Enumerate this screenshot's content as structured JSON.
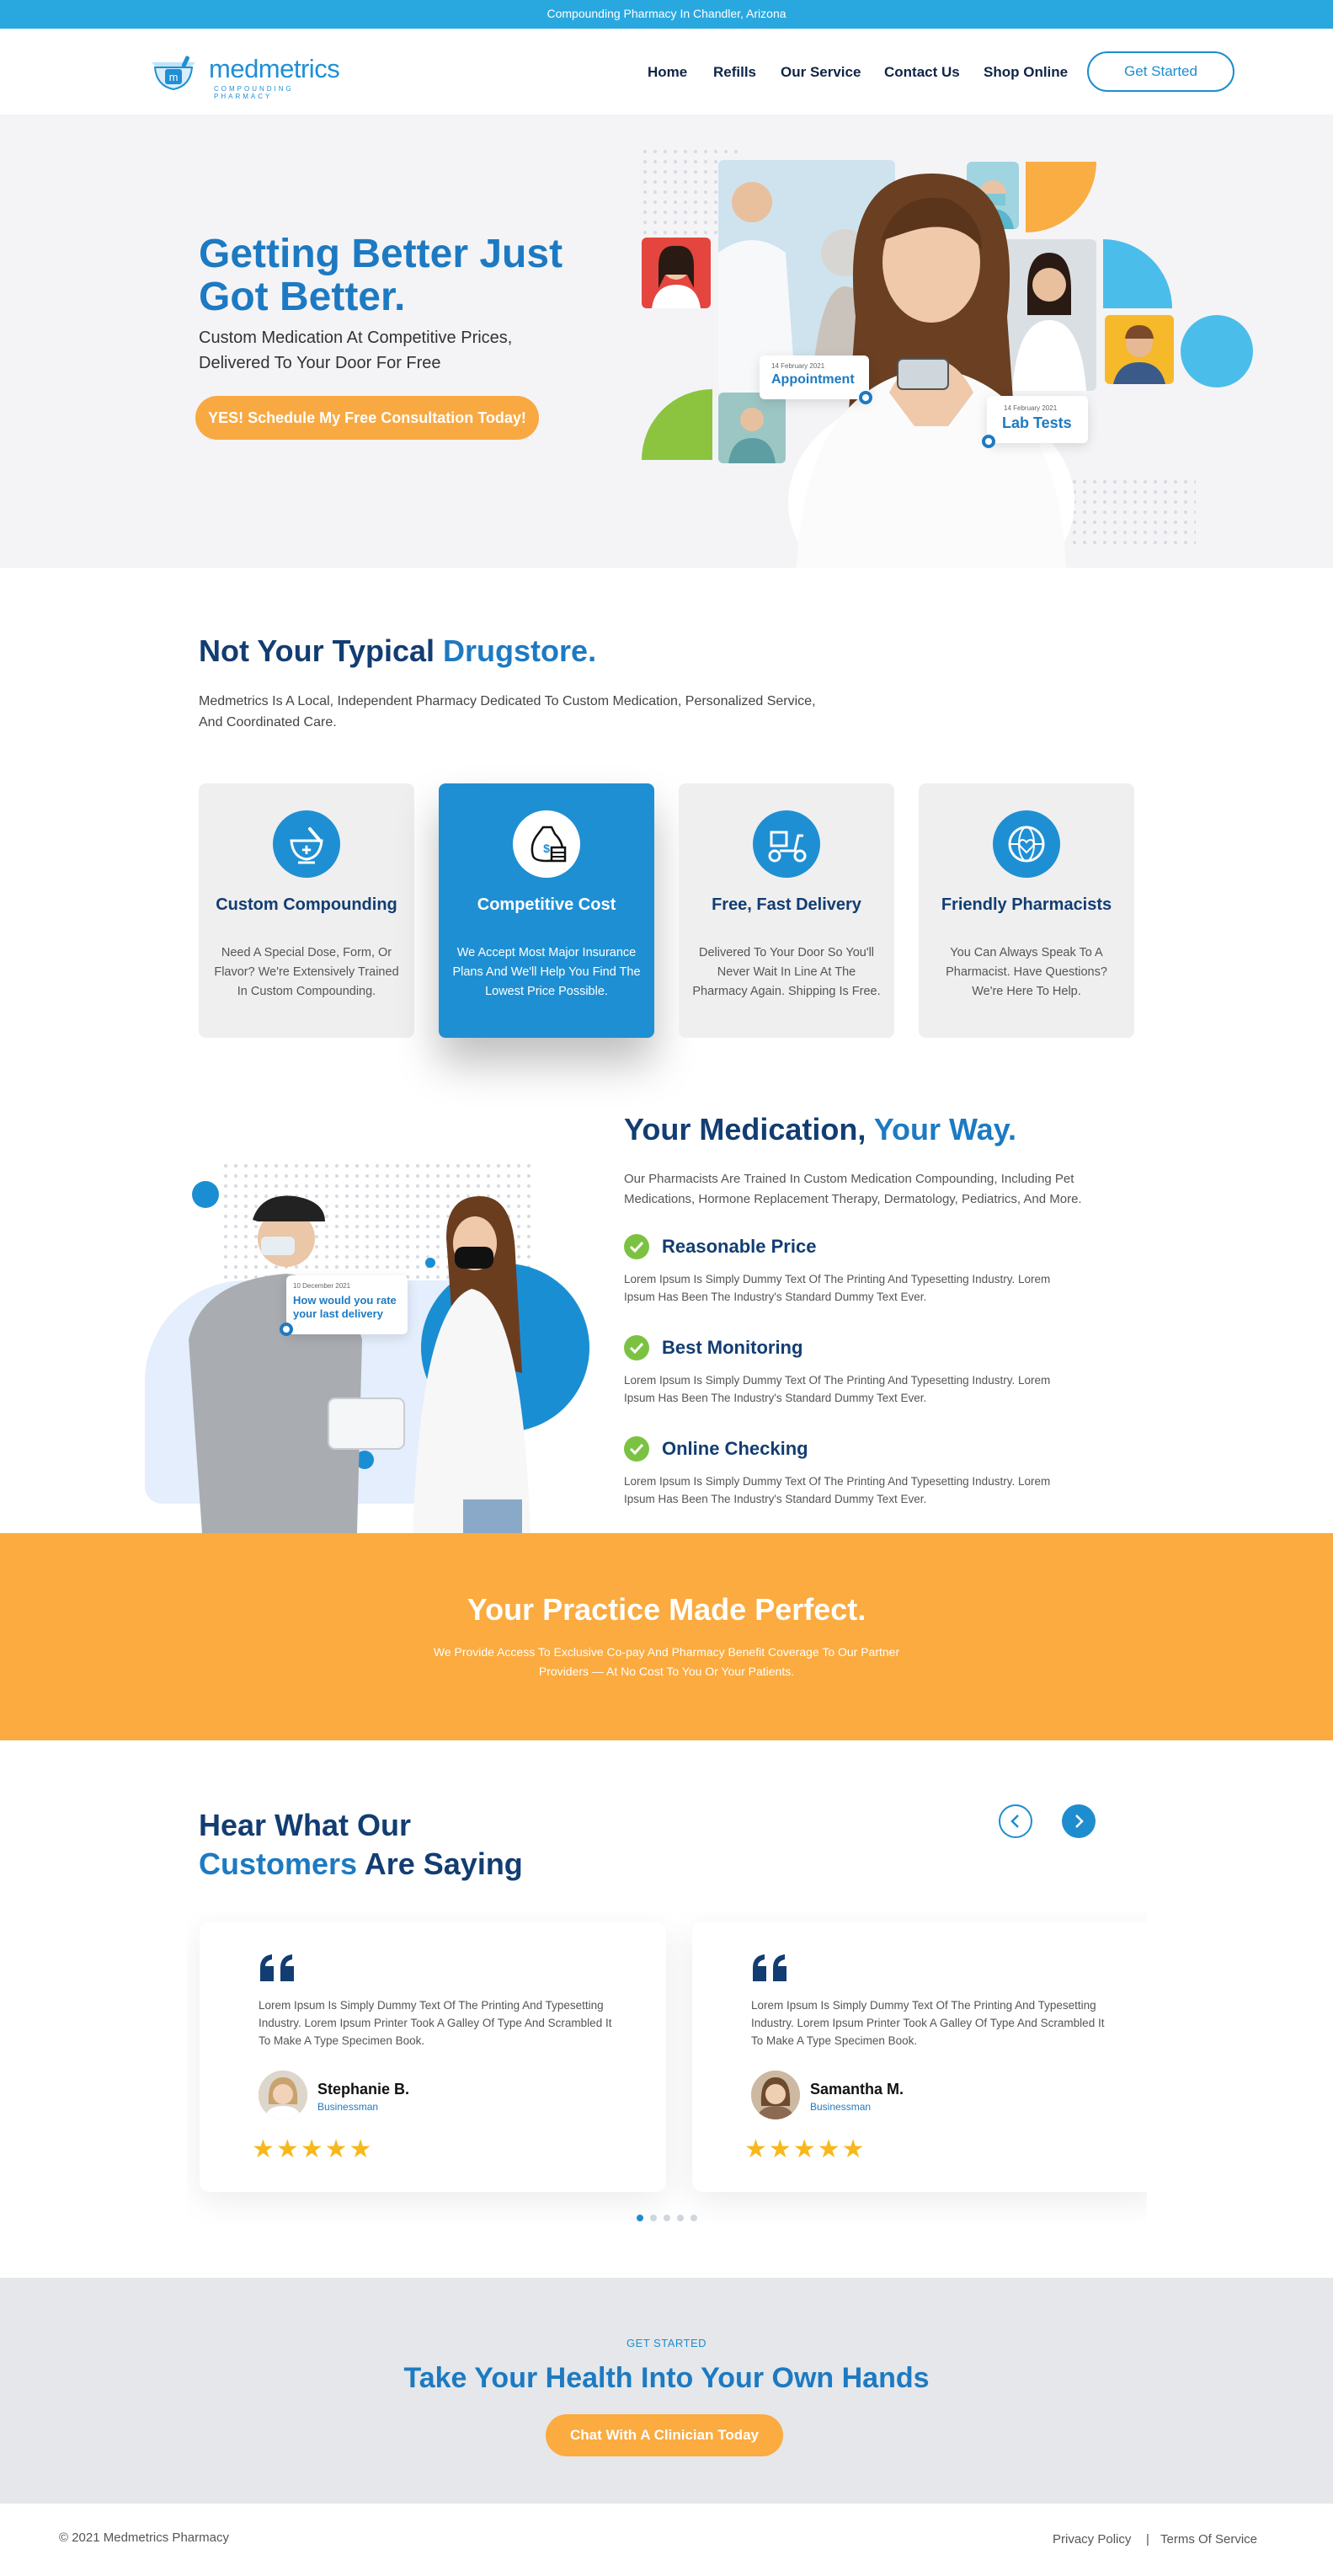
{
  "topbar": {
    "text": "Compounding Pharmacy In Chandler, Arizona"
  },
  "header": {
    "logo_name": "medmetrics",
    "logo_sub": "COMPOUNDING PHARMACY",
    "nav": [
      "Home",
      "Refills",
      "Our Service",
      "Contact Us",
      "Shop Online"
    ],
    "cta": "Get Started"
  },
  "hero": {
    "title": "Getting Better Just Got Better.",
    "subtitle": "Custom Medication At Competitive Prices, Delivered To Your Door For Free",
    "button": "YES! Schedule My Free Consultation Today!",
    "badge1": {
      "date": "14 February 2021",
      "label": "Appointment"
    },
    "badge2": {
      "date": "14 February 2021",
      "label": "Lab Tests"
    }
  },
  "intro": {
    "title_a": "Not Your Typical ",
    "title_b": "Drugstore.",
    "text": "Medmetrics Is A Local, Independent Pharmacy Dedicated To Custom Medication, Personalized Service, And Coordinated Care."
  },
  "services": [
    {
      "icon": "mortar-pestle-icon",
      "title": "Custom Compounding",
      "text": "Need A Special Dose, Form, Or Flavor? We're Extensively Trained In Custom Compounding."
    },
    {
      "icon": "money-bag-icon",
      "title": "Competitive Cost",
      "text": "We Accept Most Major Insurance Plans And We'll Help You Find The Lowest Price Possible."
    },
    {
      "icon": "delivery-scooter-icon",
      "title": "Free, Fast Delivery",
      "text": "Delivered To Your Door So You'll Never Wait In Line At The Pharmacy Again. Shipping Is Free."
    },
    {
      "icon": "globe-heart-icon",
      "title": "Friendly Pharmacists",
      "text": "You Can Always Speak To A Pharmacist. Have Questions? We're Here To Help."
    }
  ],
  "medication": {
    "title_a": "Your Medication, ",
    "title_b": "Your Way.",
    "text": "Our Pharmacists Are Trained In Custom Medication Compounding, Including Pet Medications, Hormone Replacement Therapy, Dermatology, Pediatrics, And More.",
    "badge": {
      "date": "10 December 2021",
      "label": "How would you rate your last delivery"
    },
    "features": [
      {
        "title": "Reasonable Price",
        "text": "Lorem Ipsum Is Simply Dummy Text Of The Printing And Typesetting Industry. Lorem Ipsum Has Been The Industry's Standard Dummy Text Ever."
      },
      {
        "title": "Best Monitoring",
        "text": "Lorem Ipsum Is Simply Dummy Text Of The Printing And Typesetting Industry. Lorem Ipsum Has Been The Industry's Standard Dummy Text Ever."
      },
      {
        "title": "Online Checking",
        "text": "Lorem Ipsum Is Simply Dummy Text Of The Printing And Typesetting Industry. Lorem Ipsum Has Been The Industry's Standard Dummy Text Ever."
      }
    ]
  },
  "practice": {
    "title": "Your Practice Made Perfect.",
    "text": "We Provide Access To Exclusive Co-pay And Pharmacy Benefit Coverage To Our Partner Providers — At No Cost To You Or Your Patients."
  },
  "testimonials": {
    "title_a": "Hear What Our",
    "title_b": "Customers",
    "title_c": " Are Saying",
    "items": [
      {
        "text": "Lorem Ipsum Is Simply Dummy Text Of The Printing And Typesetting Industry. Lorem Ipsum Printer Took A Galley Of Type And Scrambled It To Make A Type Specimen Book.",
        "name": "Stephanie B.",
        "role": "Businessman",
        "rating": 5
      },
      {
        "text": "Lorem Ipsum Is Simply Dummy Text Of The Printing And Typesetting Industry. Lorem Ipsum Printer Took A Galley Of Type And Scrambled It To Make A Type Specimen Book.",
        "name": "Samantha M.",
        "role": "Businessman",
        "rating": 5
      }
    ],
    "stars": "★★★★★"
  },
  "cta": {
    "eyebrow": "GET STARTED",
    "title": "Take Your Health Into Your Own Hands",
    "button": "Chat With A Clinician Today"
  },
  "footer": {
    "copyright": "© 2021 Medmetrics Pharmacy",
    "privacy": "Privacy Policy",
    "separator": "|",
    "terms": "Terms Of Service"
  },
  "colors": {
    "primary": "#1d7ac2",
    "navy": "#123d72",
    "orange": "#fbab3f",
    "topbar": "#29a8e0",
    "check": "#7cc242"
  }
}
